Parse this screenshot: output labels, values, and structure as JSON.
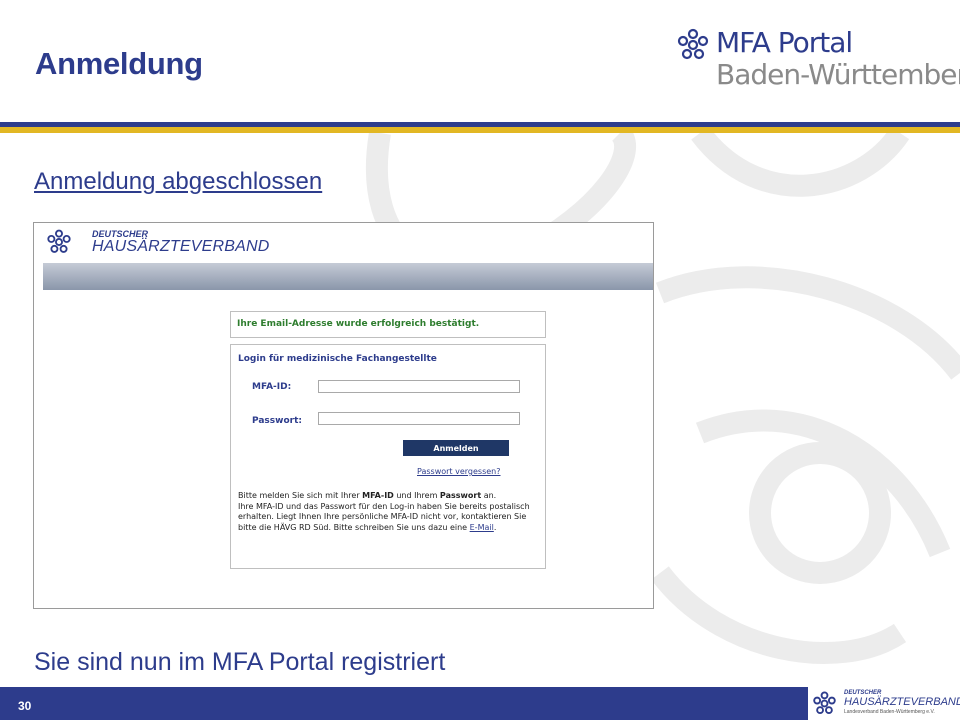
{
  "slide": {
    "title": "Anmeldung",
    "step_link": "Anmeldung abgeschlossen",
    "bottom_text": "Sie sind nun im MFA Portal registriert",
    "page_number": "30"
  },
  "brand": {
    "line1": "MFA Portal",
    "line2": "Baden-Württemberg",
    "icon": "snowflake-star-logo-icon"
  },
  "screenshot": {
    "logo_line1": "DEUTSCHER",
    "logo_line2": "HAUSÄRZTEVERBAND",
    "confirmation": "Ihre Email-Adresse wurde erfolgreich bestätigt.",
    "login_title": "Login für medizinische Fachangestellte",
    "mfa_id_label": "MFA-ID:",
    "mfa_id_value": "",
    "password_label": "Passwort:",
    "password_value": "",
    "login_button": "Anmelden",
    "forgot_link": "Passwort vergessen?",
    "info": {
      "part1": "Bitte melden Sie sich mit Ihrer ",
      "bold1": "MFA-ID",
      "part2": " und Ihrem ",
      "bold2": "Passwort",
      "part3": " an.",
      "part4": "Ihre MFA-ID und das Passwort für den Log-in haben Sie bereits postalisch erhalten. Liegt Ihnen Ihre persönliche MFA-ID nicht vor, kontaktieren Sie bitte die HÄVG RD Süd. Bitte schreiben Sie uns dazu eine ",
      "email_link": "E-Mail",
      "part5": "."
    }
  },
  "footer_logo": {
    "line1": "DEUTSCHER",
    "line2": "HAUSÄRZTEVERBAND",
    "line3": "Landesverband Baden-Württemberg e.V."
  },
  "colors": {
    "primary": "#2d3c8c",
    "accent_yellow": "#e2b723",
    "button": "#1f3766",
    "success": "#2e7d2e"
  }
}
